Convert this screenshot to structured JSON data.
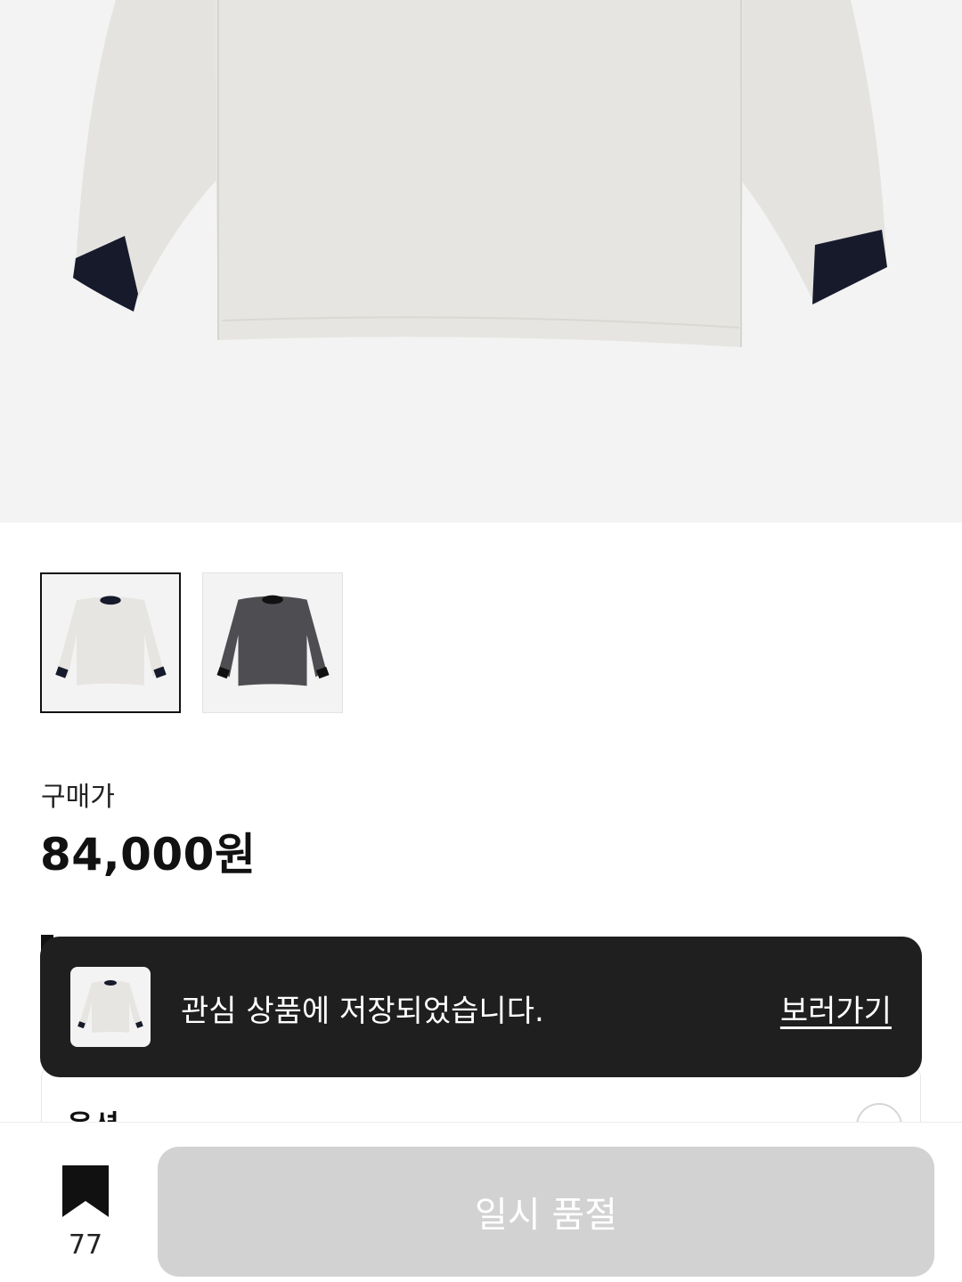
{
  "hero": {
    "image": "product-photo-light-gray-long-sleeve-tee"
  },
  "thumbnails": [
    {
      "image": "light-gray-tee-navy-trim",
      "selected": true
    },
    {
      "image": "charcoal-tee-black-trim",
      "selected": false
    }
  ],
  "price": {
    "label": "구매가",
    "value": "84,000원"
  },
  "options": {
    "title": "옵션"
  },
  "toast": {
    "message": "관심 상품에 저장되었습니다.",
    "link": "보러가기"
  },
  "bottom_bar": {
    "bookmark_icon": "bookmark-icon",
    "bookmark_count": "77",
    "primary_button": "일시 품절"
  },
  "colors": {
    "toast_bg": "#1f1f1f",
    "disabled_button": "#d2d2d2",
    "hero_bg": "#f3f3f3"
  }
}
